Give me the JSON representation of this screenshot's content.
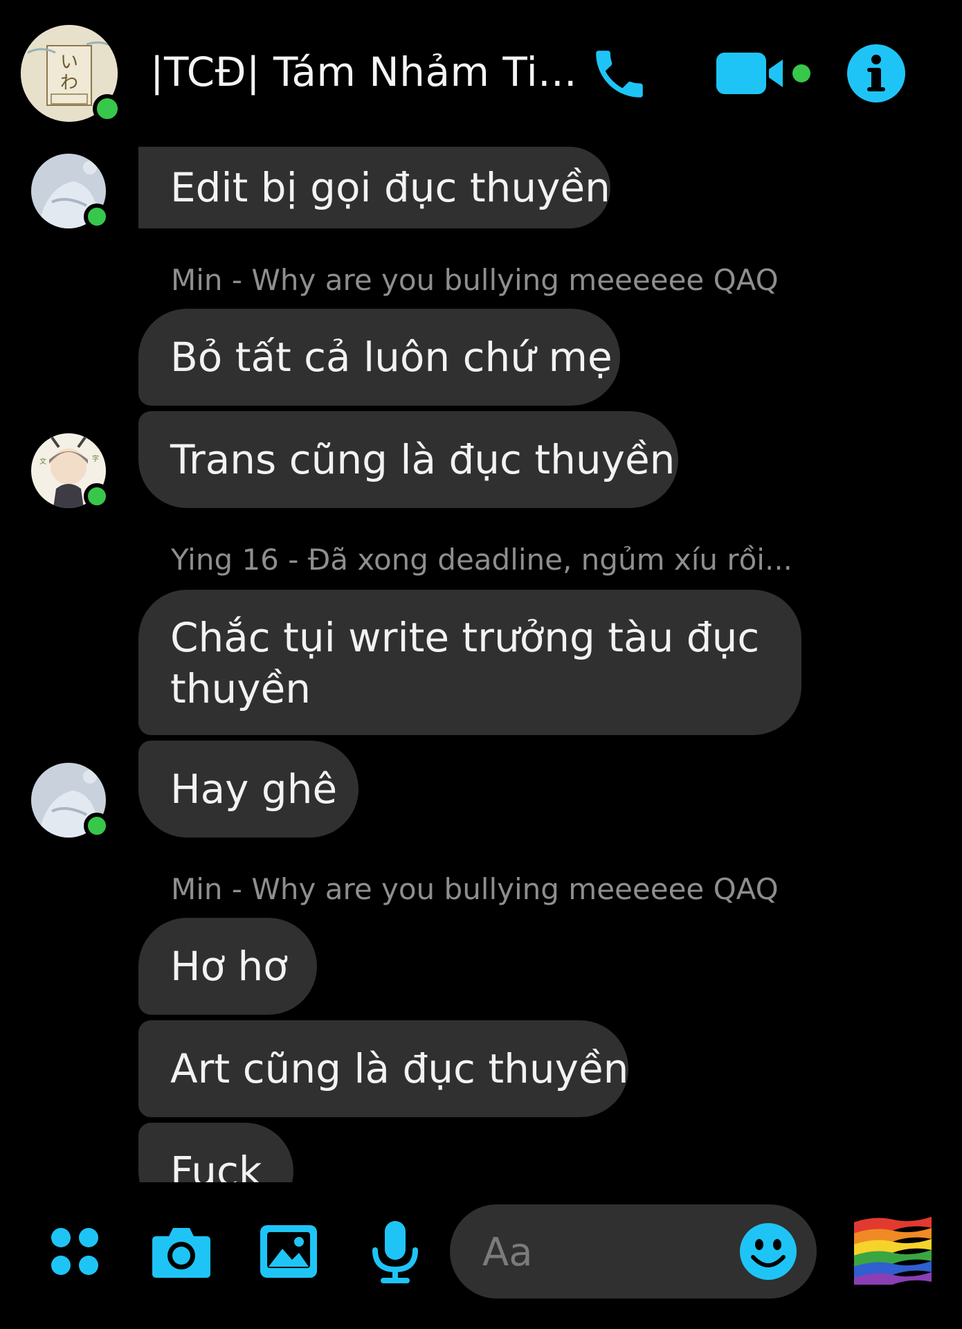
{
  "colors": {
    "accent": "#1fc4f6",
    "online": "#37c74b",
    "bubble": "#303030",
    "background": "#000000",
    "sender_text": "#8e8e8e"
  },
  "header": {
    "title": "|TCĐ| Tám Nhảm Ti...",
    "avatar_icon": "group-avatar",
    "icons": [
      "phone-icon",
      "video-icon",
      "info-icon"
    ]
  },
  "messages": [
    {
      "text": "Edit bị gọi đục thuyền"
    },
    {
      "sender": "Min - Why are you bullying meeeeee QAQ"
    },
    {
      "text": "Bỏ tất cả luôn chứ mẹ"
    },
    {
      "text": "Trans cũng là đục thuyền"
    },
    {
      "sender": "Ying 16 - Đã xong deadline, ngủm xíu rồi..."
    },
    {
      "text": "Chắc tụi write trưởng tàu đục thuyền"
    },
    {
      "text": "Hay ghê"
    },
    {
      "sender": "Min - Why are you bullying meeeeee QAQ"
    },
    {
      "text": "Hơ hơ"
    },
    {
      "text": "Art cũng là đục thuyền"
    },
    {
      "text": "Fuck"
    }
  ],
  "composer": {
    "placeholder": "Aa",
    "icons": [
      "apps-icon",
      "camera-icon",
      "gallery-icon",
      "mic-icon",
      "emoji-icon",
      "rainbow-flag-icon"
    ]
  }
}
